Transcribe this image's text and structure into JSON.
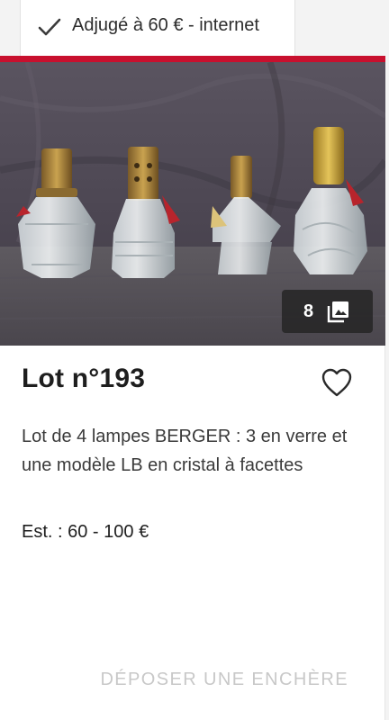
{
  "tab": {
    "label": "Adjugé à 60 € - internet",
    "icon": "check-icon"
  },
  "colors": {
    "accent": "#c8102e",
    "disabled_text": "#c8c8c8"
  },
  "lot": {
    "title": "Lot n°193",
    "photo_count": "8",
    "description": "Lot de 4 lampes BERGER : 3 en verre et une modèle LB en cristal à facettes",
    "estimate": "Est. : 60 - 100 €",
    "favorite_icon": "heart-icon",
    "gallery_icon": "images-icon"
  },
  "actions": {
    "bid_label": "DÉPOSER UNE ENCHÈRE"
  }
}
